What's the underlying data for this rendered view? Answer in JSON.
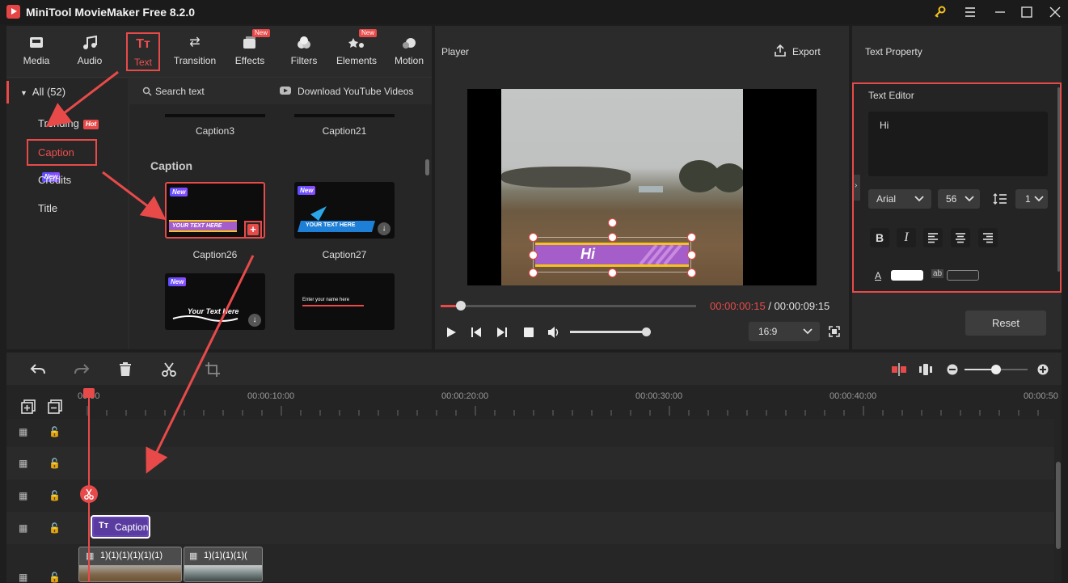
{
  "window": {
    "title": "MiniTool MovieMaker Free 8.2.0",
    "key_icon": "key-icon",
    "controls": [
      "menu-icon",
      "minimize-icon",
      "maximize-icon",
      "close-icon"
    ]
  },
  "tabs": [
    {
      "label": "Media",
      "icon": "media-icon"
    },
    {
      "label": "Audio",
      "icon": "music-note-icon"
    },
    {
      "label": "Text",
      "icon": "text-icon",
      "active": true
    },
    {
      "label": "Transition",
      "icon": "transition-icon"
    },
    {
      "label": "Effects",
      "icon": "effects-icon",
      "badge": "New"
    },
    {
      "label": "Filters",
      "icon": "filters-icon"
    },
    {
      "label": "Elements",
      "icon": "elements-icon",
      "badge": "New"
    },
    {
      "label": "Motion",
      "icon": "motion-icon"
    }
  ],
  "categories": {
    "all": "All (52)",
    "items": [
      {
        "label": "Trending",
        "badge": "Hot"
      },
      {
        "label": "Caption",
        "badge": "New",
        "active": true
      },
      {
        "label": "Credits"
      },
      {
        "label": "Title"
      }
    ]
  },
  "content": {
    "search_placeholder": "Search text",
    "download_label": "Download YouTube Videos",
    "top_row": [
      "Caption3",
      "Caption21"
    ],
    "section_title": "Caption",
    "thumbs": [
      {
        "label": "Caption26",
        "badge": "New",
        "text": "YOUR TEXT HERE"
      },
      {
        "label": "Caption27",
        "badge": "New",
        "text": "YOUR TEXT HERE"
      },
      {
        "label": "",
        "badge": "New",
        "text": "Your Text Here"
      },
      {
        "label": "",
        "text": "Enter your name here"
      }
    ]
  },
  "player": {
    "title": "Player",
    "export_label": "Export",
    "caption_text": "Hi",
    "current_time": "00:00:00:15",
    "separator": " / ",
    "total_time": "00:00:09:15",
    "progress": 0.08,
    "volume": 1.0,
    "aspect_ratio": "16:9"
  },
  "text_property": {
    "title": "Text Property",
    "editor_label": "Text Editor",
    "editor_value": "Hi",
    "font": "Arial",
    "size": "56",
    "line_spacing": "1",
    "reset_label": "Reset"
  },
  "timeline": {
    "ticks": [
      "00:00",
      "00:00:10:00",
      "00:00:20:00",
      "00:00:30:00",
      "00:00:40:00",
      "00:00:50"
    ],
    "caption_clip": "Caption",
    "video_clips": [
      "1)(1)(1)(1)(1)(1)",
      "1)(1)(1)(1)("
    ],
    "zoom": 0.5
  },
  "colors": {
    "accent": "#e84a4a",
    "panel": "#2b2b2b",
    "caption_purple": "#a55ec9",
    "caption_yellow": "#f6c21c"
  }
}
